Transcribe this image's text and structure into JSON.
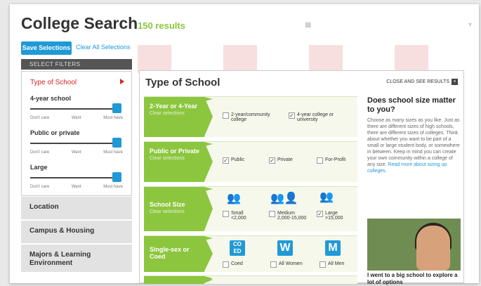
{
  "header": {
    "title": "College Search",
    "results": "150 results"
  },
  "toolbar": {
    "save_label": "Save Selections",
    "clear_all_label": "Clear All Selections"
  },
  "filters": {
    "heading": "SELECT FILTERS",
    "active": "Type of School",
    "sliders": [
      {
        "label": "4-year school",
        "ticks": [
          "Don't care",
          "Want",
          "Must have"
        ],
        "level": "Must have"
      },
      {
        "label": "Public or private",
        "ticks": [
          "Don't care",
          "Want",
          "Must have"
        ],
        "level": "Must have"
      },
      {
        "label": "Large",
        "ticks": [
          "Don't care",
          "Want",
          "Must have"
        ],
        "level": "Must have"
      }
    ],
    "nav": [
      "Location",
      "Campus & Housing",
      "Majors & Learning Environment"
    ]
  },
  "panel": {
    "title": "Type of School",
    "close_label": "CLOSE AND SEE RESULTS",
    "rows": [
      {
        "name": "2-Year or 4-Year",
        "clear": "Clear selections",
        "options": [
          {
            "label": "2-year/community college",
            "checked": false
          },
          {
            "label": "4-year college or university",
            "checked": true
          }
        ]
      },
      {
        "name": "Public or Private",
        "clear": "Clear selections",
        "options": [
          {
            "label": "Public",
            "checked": true
          },
          {
            "label": "Private",
            "checked": true
          },
          {
            "label": "For-Profit",
            "checked": false
          }
        ]
      },
      {
        "name": "School Size",
        "clear": "Clear selections",
        "options": [
          {
            "label": "Small",
            "sub": "<2,000",
            "checked": false
          },
          {
            "label": "Medium",
            "sub": "2,000-15,000",
            "checked": false
          },
          {
            "label": "Large",
            "sub": ">15,000",
            "checked": true
          }
        ]
      },
      {
        "name": "Single-sex or Coed",
        "clear": "",
        "options": [
          {
            "label": "Coed",
            "icon": "CO ED",
            "checked": false
          },
          {
            "label": "All Women",
            "icon": "W",
            "checked": false
          },
          {
            "label": "All Men",
            "icon": "M",
            "checked": false
          }
        ]
      }
    ],
    "side": {
      "heading": "Does school size matter to you?",
      "body": "Choose as many sizes as you like. Just as there are different sizes of high schools, there are different sizes of colleges. Think about whether you want to be part of a small or large student body, or somewhere in between. Keep in mind you can create your own community within a college of any size.",
      "link": "Read more about sizing up colleges.",
      "video_caption": "I went to a big school to explore a lot of options"
    }
  },
  "colors": {
    "accent": "#1f9ad6",
    "green": "#8cc63f",
    "red": "#dd2222"
  }
}
